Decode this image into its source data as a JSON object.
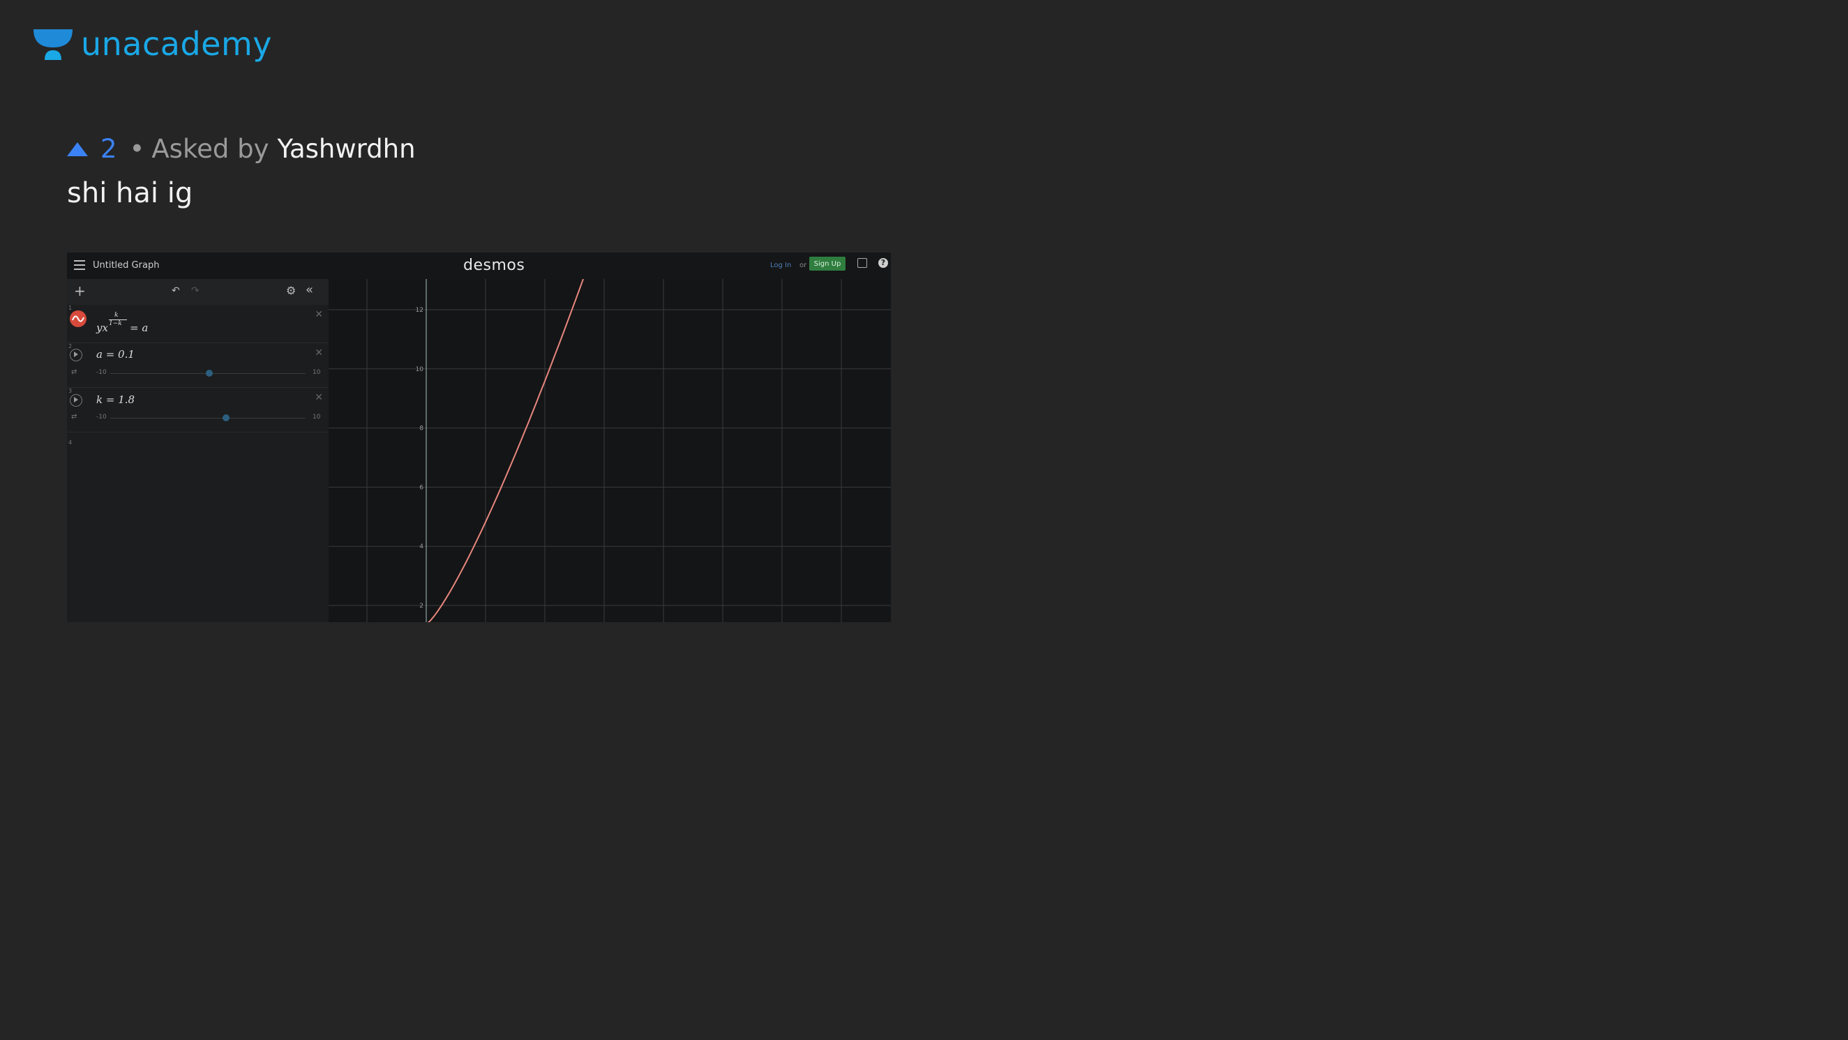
{
  "brand": {
    "name": "unacademy",
    "logo_color": "#1aa8e6"
  },
  "question": {
    "upvotes": "2",
    "separator": "•",
    "asked_by_label": "Asked by",
    "author": "Yashwrdhn",
    "title": "shi hai ig"
  },
  "desmos": {
    "graph_title": "Untitled Graph",
    "brand": "desmos",
    "login_label": "Log In",
    "or_label": "or",
    "signup_label": "Sign Up",
    "help_label": "?",
    "expressions": [
      {
        "index": "1",
        "latex": "yx^(k/(1−k)) = a",
        "exponent_num": "k",
        "exponent_den": "1−k"
      },
      {
        "index": "2",
        "latex": "a = 0.1",
        "slider_min": "-10",
        "slider_max": "10",
        "value": 0.1
      },
      {
        "index": "3",
        "latex": "k = 1.8",
        "slider_min": "-10",
        "slider_max": "10",
        "value": 1.8
      }
    ],
    "next_index": "4",
    "graph": {
      "y_ticks": [
        "12",
        "10",
        "8",
        "6",
        "4",
        "2"
      ],
      "curve_color": "#e8877e",
      "grid_color": "#3a3b3c",
      "axis_color": "#8fa5a5"
    }
  }
}
